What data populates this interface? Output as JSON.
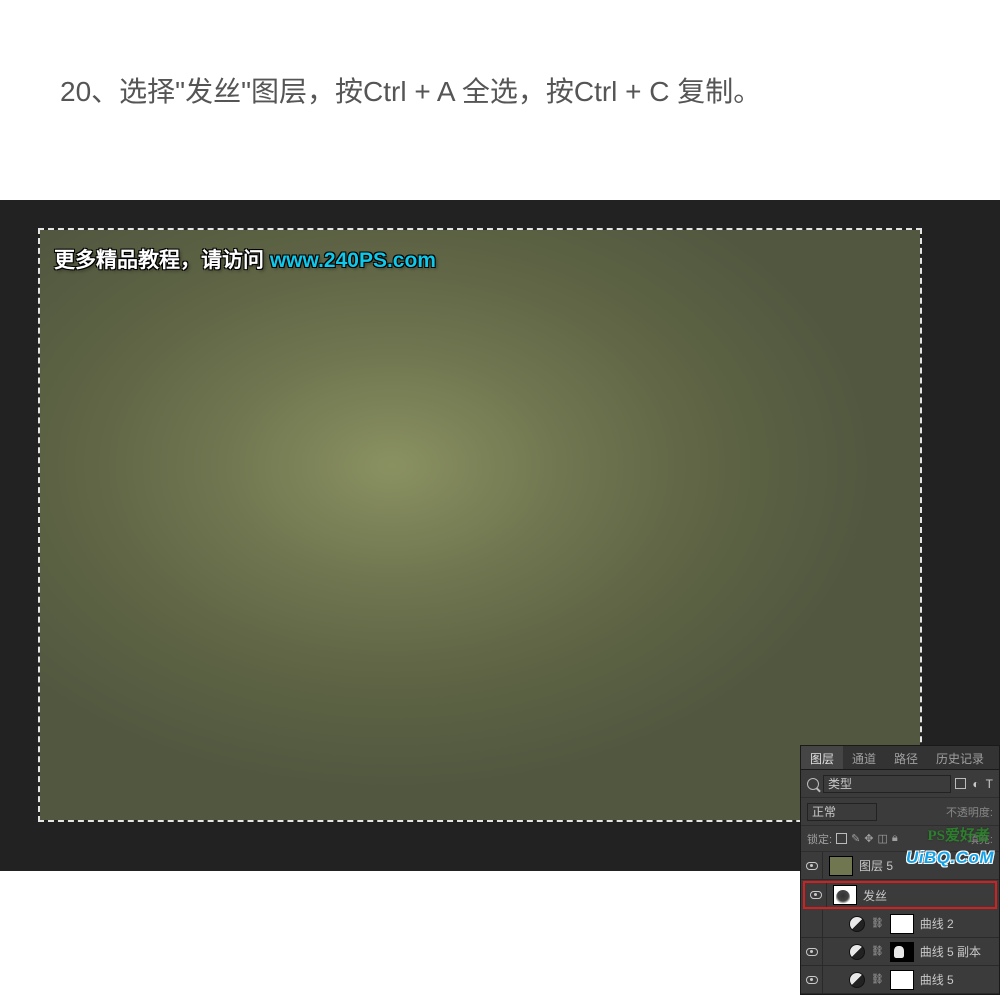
{
  "instruction": "20、选择\"发丝\"图层，按Ctrl + A 全选，按Ctrl + C 复制。",
  "watermark": {
    "prefix": "更多精品教程，请访问 ",
    "url": "www.240PS.com"
  },
  "panel": {
    "tabs": {
      "layers": "图层",
      "channels": "通道",
      "paths": "路径",
      "history": "历史记录"
    },
    "type_label": "类型",
    "blend_mode": "正常",
    "opacity_label": "不透明度:",
    "lock_label": "锁定:",
    "fill_label": "填充:",
    "filter_icons": {
      "image": "▭",
      "adjust": "◐",
      "type": "T"
    }
  },
  "layers": {
    "l0": {
      "name": "图层 5"
    },
    "l1": {
      "name": "发丝"
    },
    "l2": {
      "name": "曲线 2"
    },
    "l3": {
      "name": "曲线 5 副本"
    },
    "l4": {
      "name": "曲线 5"
    }
  },
  "bottom_watermark": "UiBQ.CoM",
  "bottom_watermark2": "PS爱好者"
}
